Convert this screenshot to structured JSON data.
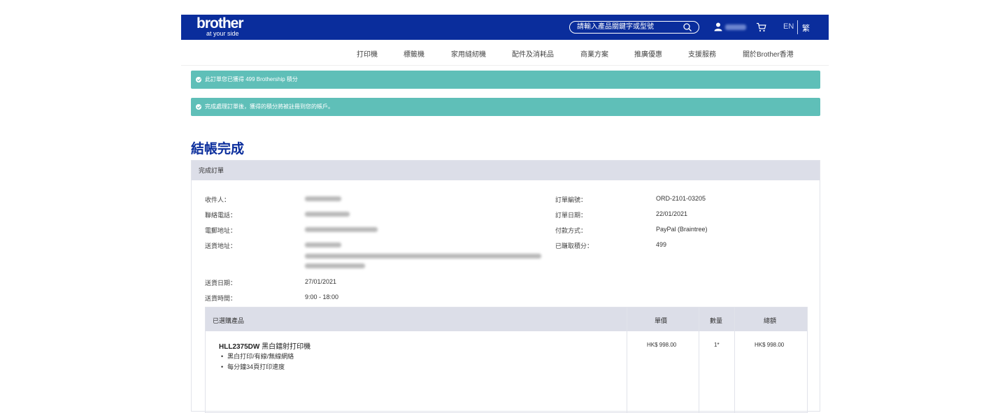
{
  "header": {
    "logo_brand": "brother",
    "logo_tagline": "at your side",
    "search_placeholder": "請輸入產品關鍵字或型號",
    "lang_en": "EN",
    "lang_tc": "繁"
  },
  "nav": [
    "打印機",
    "標籤機",
    "家用縫紉機",
    "配件及消耗品",
    "商業方案",
    "推廣優惠",
    "支援服務",
    "關於Brother香港"
  ],
  "alerts": [
    "此訂單您已獲得 499 Brothership 積分",
    "完成處理訂單後，獲得的積分將被註冊到您的帳戶。"
  ],
  "page_title": "結帳完成",
  "order_panel": {
    "heading": "完成訂單",
    "left_labels": [
      "收件人：",
      "聯絡電話：",
      "電郵地址：",
      "送貨地址：",
      "送貨日期：",
      "送貨時間："
    ],
    "delivery_date": "27/01/2021",
    "delivery_time": "9:00 - 18:00",
    "right_labels": [
      "訂單編號：",
      "訂單日期：",
      "付款方式：",
      "已賺取積分："
    ],
    "right_values": [
      "ORD-2101-03205",
      "22/01/2021",
      "PayPal (Braintree)",
      "499"
    ]
  },
  "products": {
    "headers": [
      "已選購產品",
      "單價",
      "數量",
      "總額"
    ],
    "items": [
      {
        "model": "HLL2375DW",
        "name": "黑白鐳射打印機",
        "features": [
          "黑白打印/有線/無線網絡",
          "每分鐘34頁打印速度"
        ],
        "unit_price": "HK$ 998.00",
        "qty": "1*",
        "total": "HK$ 998.00"
      }
    ]
  }
}
